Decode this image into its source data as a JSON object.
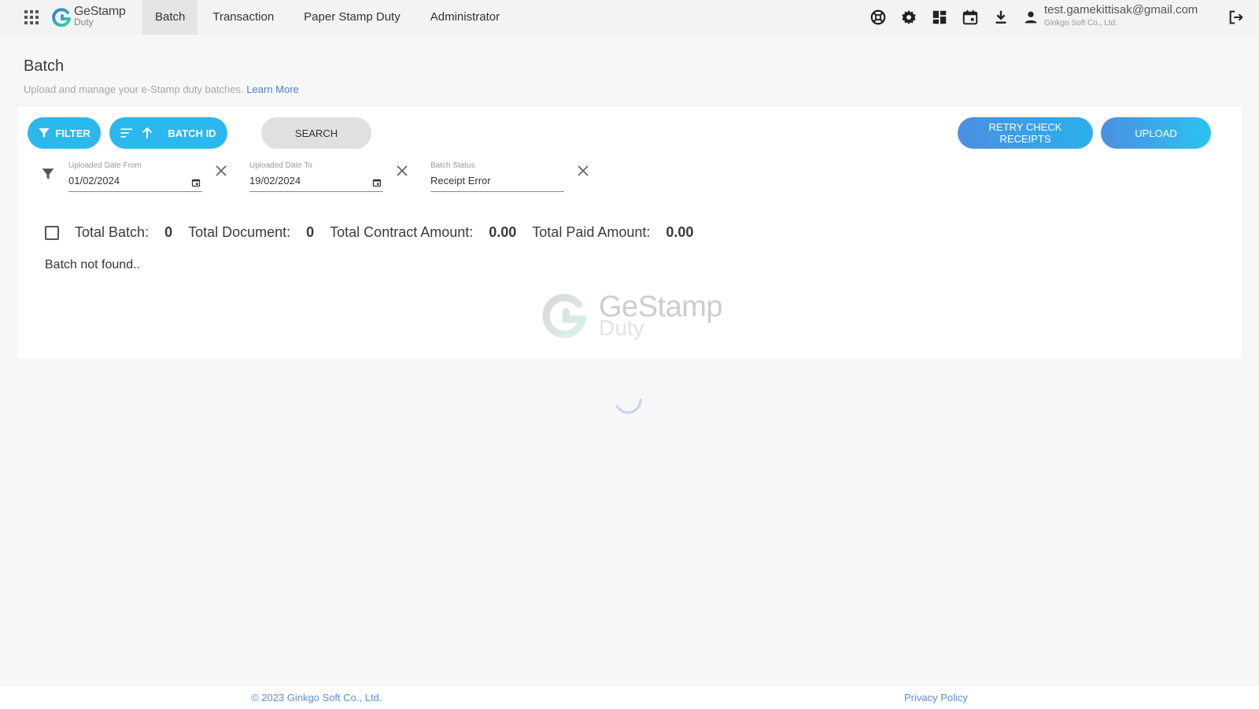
{
  "app": {
    "logo_line1": "GeStamp",
    "logo_line2": "Duty"
  },
  "nav": {
    "items": [
      {
        "label": "Batch",
        "active": true
      },
      {
        "label": "Transaction"
      },
      {
        "label": "Paper Stamp Duty"
      },
      {
        "label": "Administrator"
      }
    ]
  },
  "header_icons": [
    "support-icon",
    "settings-icon",
    "dashboard-icon",
    "calendar-icon",
    "download-icon",
    "user-icon",
    "logout-icon"
  ],
  "user": {
    "email": "test.gamekittisak@gmail.com",
    "org": "Ginkgo Soft Co., Ltd."
  },
  "page": {
    "title": "Batch",
    "subtitle": "Upload and manage your e-Stamp duty batches.",
    "learn_more": "Learn More"
  },
  "toolbar": {
    "filter_label": "FILTER",
    "sort_label": "BATCH ID",
    "search_label": "SEARCH",
    "retry_label": "RETRY CHECK RECEIPTS",
    "upload_label": "UPLOAD"
  },
  "filters": {
    "date_from": {
      "label": "Uploaded Date From",
      "value": "01/02/2024"
    },
    "date_to": {
      "label": "Uploaded Date To",
      "value": "19/02/2024"
    },
    "status": {
      "label": "Batch Status",
      "value": "Receipt Error"
    }
  },
  "summary": {
    "total_batch_label": "Total Batch:",
    "total_batch": "0",
    "total_document_label": "Total Document:",
    "total_document": "0",
    "total_contract_label": "Total Contract Amount:",
    "total_contract": "0.00",
    "total_paid_label": "Total Paid Amount:",
    "total_paid": "0.00"
  },
  "empty_message": "Batch not found..",
  "watermark": {
    "line1": "GeStamp",
    "line2": "Duty"
  },
  "footer": {
    "copyright": "© 2023 Ginkgo Soft Co., Ltd.",
    "privacy": "Privacy Policy"
  },
  "colors": {
    "primary": "#2bb8ec",
    "gradient_start": "#4b8fe2",
    "link": "#4a7fd4"
  }
}
